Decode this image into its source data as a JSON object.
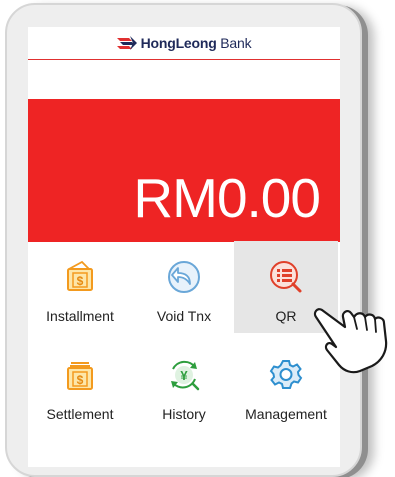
{
  "header": {
    "brand_bold": "HongLeong",
    "brand_regular": " Bank"
  },
  "balance": {
    "amount": "RM0.00"
  },
  "menu": [
    {
      "label": "Installment",
      "icon": "installment-wallet-icon"
    },
    {
      "label": "Void Tnx",
      "icon": "void-transaction-icon"
    },
    {
      "label": "QR",
      "icon": "qr-scan-icon",
      "state": "pressed"
    },
    {
      "label": "Settlement",
      "icon": "settlement-wallet-icon"
    },
    {
      "label": "History",
      "icon": "history-yen-icon"
    },
    {
      "label": "Management",
      "icon": "management-gear-icon"
    }
  ],
  "colors": {
    "banner": "#ee2424",
    "icon_orange": "#f39a1e",
    "icon_blue": "#6aa7d8",
    "icon_red": "#e0402a",
    "icon_green": "#2e9e3e",
    "icon_teal": "#2e8fcf",
    "brand_navy": "#1f2a5a",
    "pressed_cell": "#e6e6e6"
  }
}
